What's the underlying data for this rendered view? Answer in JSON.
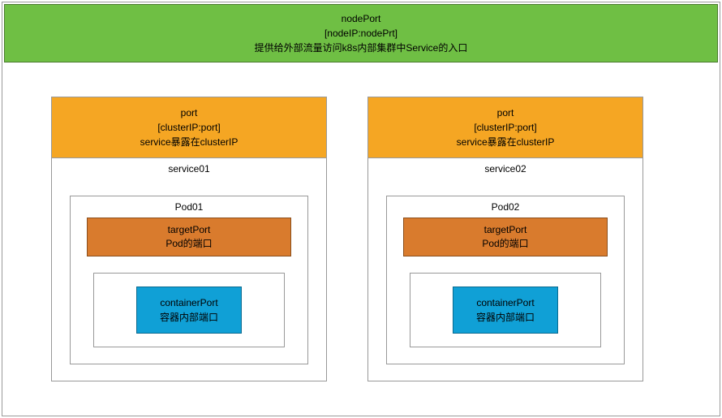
{
  "nodePort": {
    "title": "nodePort",
    "addr": "[nodeIP:nodePrt]",
    "desc": "提供给外部流量访问k8s内部集群中Service的入口"
  },
  "services": [
    {
      "port": {
        "title": "port",
        "addr": "[clusterIP:port]",
        "desc": "service暴露在clusterIP"
      },
      "name": "service01",
      "pod": {
        "name": "Pod01",
        "targetPort": {
          "title": "targetPort",
          "desc": "Pod的端口"
        },
        "containerPort": {
          "title": "containerPort",
          "desc": "容器内部端口"
        }
      }
    },
    {
      "port": {
        "title": "port",
        "addr": "[clusterIP:port]",
        "desc": "service暴露在clusterIP"
      },
      "name": "service02",
      "pod": {
        "name": "Pod02",
        "targetPort": {
          "title": "targetPort",
          "desc": "Pod的端口"
        },
        "containerPort": {
          "title": "containerPort",
          "desc": "容器内部端口"
        }
      }
    }
  ]
}
